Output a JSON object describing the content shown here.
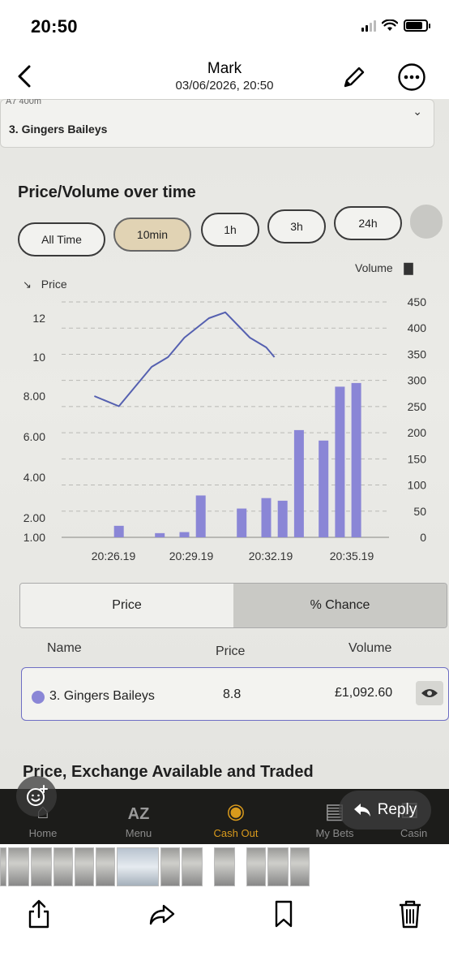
{
  "status_bar": {
    "time": "20:50"
  },
  "header": {
    "title": "Mark",
    "subtitle": "03/06/2026, 20:50"
  },
  "photo": {
    "selection": {
      "partial_top_text": "A7 400m",
      "value": "3. Gingers Baileys"
    },
    "panel_title": "Price/Volume over time",
    "time_ranges": [
      {
        "label": "All Time",
        "active": false
      },
      {
        "label": "10min",
        "active": true
      },
      {
        "label": "1h",
        "active": false
      },
      {
        "label": "3h",
        "active": false
      },
      {
        "label": "24h",
        "active": false
      }
    ],
    "chart_data": {
      "type": "bar+line",
      "left_axis_title": "Price",
      "right_axis_title": "Volume",
      "left_ticks": [
        "12",
        "10",
        "8.00",
        "6.00",
        "4.00",
        "2.00",
        "1.00"
      ],
      "right_ticks": [
        "450",
        "400",
        "350",
        "300",
        "250",
        "200",
        "150",
        "100",
        "50",
        "0"
      ],
      "x_ticks": [
        "20:26.19",
        "20:29.19",
        "20:32.19",
        "20:35.19"
      ],
      "volume_axis_range": [
        0,
        450
      ],
      "volume_bars": [
        {
          "x": 20.45,
          "y": 22
        },
        {
          "x": 20.5,
          "y": 8
        },
        {
          "x": 20.53,
          "y": 10
        },
        {
          "x": 20.55,
          "y": 80
        },
        {
          "x": 20.6,
          "y": 55
        },
        {
          "x": 20.63,
          "y": 75
        },
        {
          "x": 20.65,
          "y": 70
        },
        {
          "x": 20.67,
          "y": 205
        },
        {
          "x": 20.7,
          "y": 185
        },
        {
          "x": 20.72,
          "y": 288
        },
        {
          "x": 20.74,
          "y": 295
        }
      ],
      "price_line": [
        {
          "x": 20.42,
          "y": 8.0
        },
        {
          "x": 20.45,
          "y": 7.5
        },
        {
          "x": 20.49,
          "y": 9.5
        },
        {
          "x": 20.51,
          "y": 10.0
        },
        {
          "x": 20.53,
          "y": 11.0
        },
        {
          "x": 20.56,
          "y": 12.0
        },
        {
          "x": 20.58,
          "y": 12.3
        },
        {
          "x": 20.61,
          "y": 11.0
        },
        {
          "x": 20.63,
          "y": 10.5
        },
        {
          "x": 20.64,
          "y": 10.0
        }
      ],
      "grid": true
    },
    "toggle": {
      "left": "Price",
      "right": "% Chance",
      "active": "right"
    },
    "table": {
      "headers": {
        "name": "Name",
        "price": "Price",
        "volume": "Volume"
      },
      "rows": [
        {
          "name": "3. Gingers Baileys",
          "price": "8.8",
          "volume": "£1,092.60",
          "color": "#8a86d6"
        }
      ]
    },
    "next_section_title": "Price, Exchange Available and Traded",
    "app_tabs": [
      {
        "label": "Home",
        "icon": "home-icon"
      },
      {
        "label": "Menu",
        "icon": "az-icon"
      },
      {
        "label": "Cash Out",
        "icon": "cashout-icon",
        "active": true
      },
      {
        "label": "My Bets",
        "icon": "betslip-icon"
      },
      {
        "label": "Casin",
        "icon": "dice-icon"
      }
    ]
  },
  "reply_label": "Reply",
  "colors": {
    "accent": "#d99a1c",
    "bars": "#8a86d6",
    "line": "#5560b0"
  }
}
